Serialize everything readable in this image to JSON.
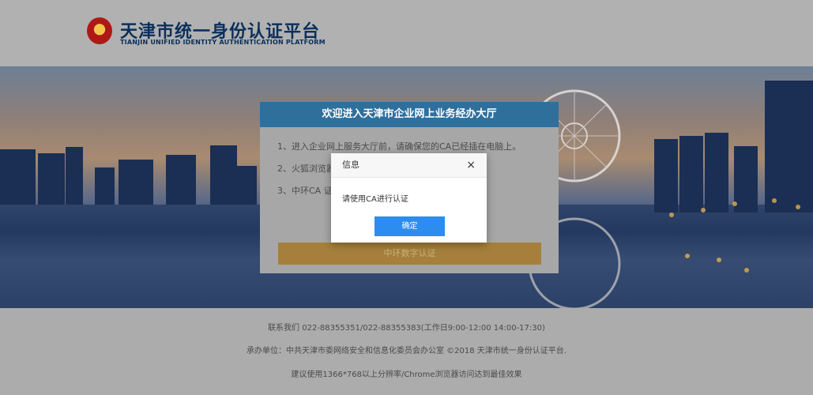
{
  "header": {
    "title_cn": "天津市统一身份认证平台",
    "title_en": "TIANJIN UNIFIED IDENTITY AUTHENTICATION PLATFORM"
  },
  "panel": {
    "title": "欢迎进入天津市企业网上业务经办大厅",
    "items": [
      "1、进入企业网上服务大厅前，请确保您的CA已经插在电脑上。",
      "2、火狐浏览器",
      "3、中环CA 证书"
    ],
    "button_label": "中环数字认证"
  },
  "dialog": {
    "title": "信息",
    "close_symbol": "×",
    "message": "请使用CA进行认证",
    "confirm_label": "确定"
  },
  "footer": {
    "contact": "联系我们 022-88355351/022-88355383(工作日9:00-12:00 14:00-17:30)",
    "organizer": "承办单位：中共天津市委网络安全和信息化委员会办公室      ©2018 天津市统一身份认证平台.",
    "recommend": "建议使用1366*768以上分辨率/Chrome浏览器访问达到最佳效果"
  }
}
